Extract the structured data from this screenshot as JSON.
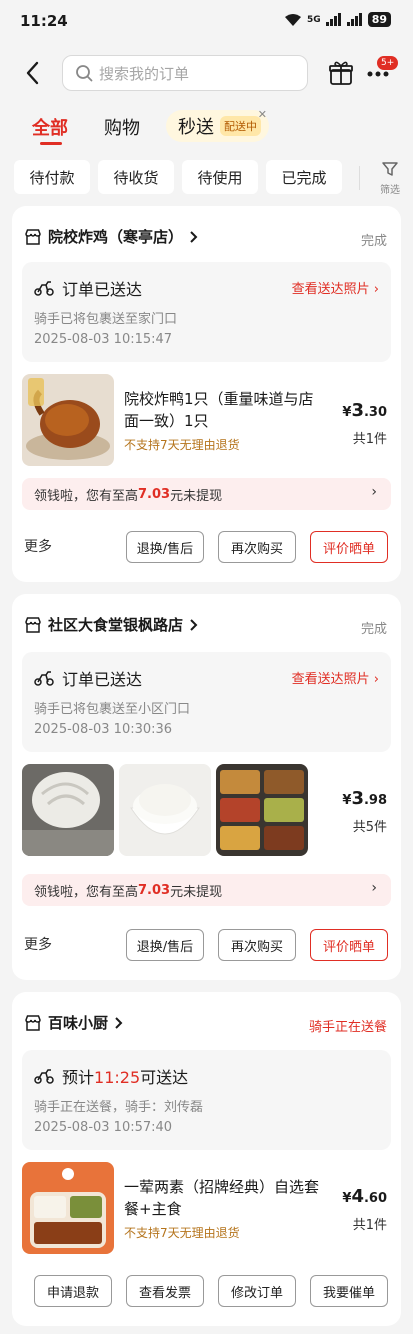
{
  "status_bar": {
    "time": "11:24",
    "network": "5G",
    "battery": "89"
  },
  "header": {
    "search_placeholder": "搜索我的订单",
    "notif_badge": "5+"
  },
  "tabs": [
    {
      "label": "全部",
      "active": true
    },
    {
      "label": "购物",
      "active": false
    }
  ],
  "miaosong": {
    "label": "秒送",
    "tag": "配送中"
  },
  "filters": [
    "待付款",
    "待收货",
    "待使用",
    "已完成"
  ],
  "filter_button": "筛选",
  "orders": [
    {
      "shop": "院校炸鸡（寒亭店）",
      "status": "完成",
      "delivery": {
        "title": "订单已送达",
        "link": "查看送达照片",
        "note": "骑手已将包裹送至家门口",
        "time": "2025-08-03 10:15:47"
      },
      "item_name": "院校炸鸭1只（重量味道与店面一致）1只",
      "return_note": "不支持7天无理由退货",
      "price_symbol": "¥",
      "price_int": "3",
      "price_dec": ".30",
      "count": "共1件",
      "promo": {
        "pre": "领钱啦，您有至高",
        "amount": "7.03",
        "post": "元未提现"
      },
      "more": "更多",
      "buttons": [
        "退换/售后",
        "再次购买",
        "评价晒单"
      ]
    },
    {
      "shop": "社区大食堂银枫路店",
      "status": "完成",
      "delivery": {
        "title": "订单已送达",
        "link": "查看送达照片",
        "note": "骑手已将包裹送至小区门口",
        "time": "2025-08-03 10:30:36"
      },
      "price_symbol": "¥",
      "price_int": "3",
      "price_dec": ".98",
      "count": "共5件",
      "promo": {
        "pre": "领钱啦，您有至高",
        "amount": "7.03",
        "post": "元未提现"
      },
      "more": "更多",
      "buttons": [
        "退换/售后",
        "再次购买",
        "评价晒单"
      ]
    },
    {
      "shop": "百味小厨",
      "status": "骑手正在送餐",
      "delivery": {
        "pre": "预计",
        "eta": "11:25",
        "post": "可送达",
        "note": "骑手正在送餐，骑手：刘传磊",
        "time": "2025-08-03 10:57:40"
      },
      "item_name": "一荤两素（招牌经典）自选套餐+主食",
      "return_note": "不支持7天无理由退货",
      "price_symbol": "¥",
      "price_int": "4",
      "price_dec": ".60",
      "count": "共1件",
      "buttons": [
        "申请退款",
        "查看发票",
        "修改订单",
        "我要催单"
      ]
    }
  ],
  "colors": {
    "accent": "#e02e24",
    "background": "#f4f4f4"
  }
}
